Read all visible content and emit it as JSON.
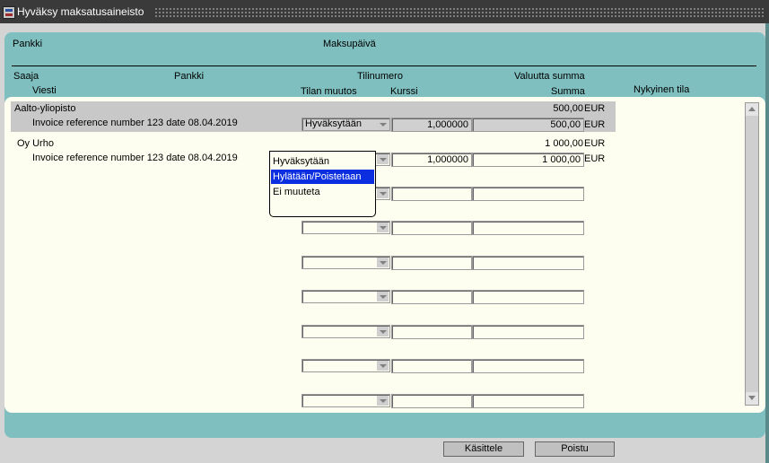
{
  "window": {
    "title": "Hyväksy maksatusaineisto"
  },
  "header": {
    "pankki": "Pankki",
    "maksupaiva": "Maksupäivä"
  },
  "columns": {
    "saaja": "Saaja",
    "pankki": "Pankki",
    "tilinumero": "Tilinumero",
    "valuutta_summa": "Valuutta summa",
    "viesti": "Viesti",
    "tilan_muutos": "Tilan muutos",
    "kurssi": "Kurssi",
    "summa": "Summa",
    "nykyinen_tila": "Nykyinen tila"
  },
  "rows": [
    {
      "saaja": "Aalto-yliopisto",
      "viesti": "Invoice reference number 123 date 08.04.2019",
      "valuutta_summa": "500,00",
      "valuutta": "EUR",
      "tilan_muutos": "Hyväksytään",
      "kurssi": "1,000000",
      "summa": "500,00",
      "summa_valuutta": "EUR"
    },
    {
      "saaja": "Oy Urho",
      "viesti": "Invoice reference number 123 date 08.04.2019",
      "valuutta_summa": "1 000,00",
      "valuutta": "EUR",
      "tilan_muutos": "",
      "kurssi": "1,000000",
      "summa": "1 000,00",
      "summa_valuutta": "EUR"
    }
  ],
  "dropdown": {
    "options": [
      "Hyväksytään",
      "Hylätään/Poistetaan",
      "Ei muuteta"
    ],
    "highlighted": "Hylätään/Poistetaan"
  },
  "buttons": {
    "kasittele": "Käsittele",
    "poistu": "Poistu"
  }
}
